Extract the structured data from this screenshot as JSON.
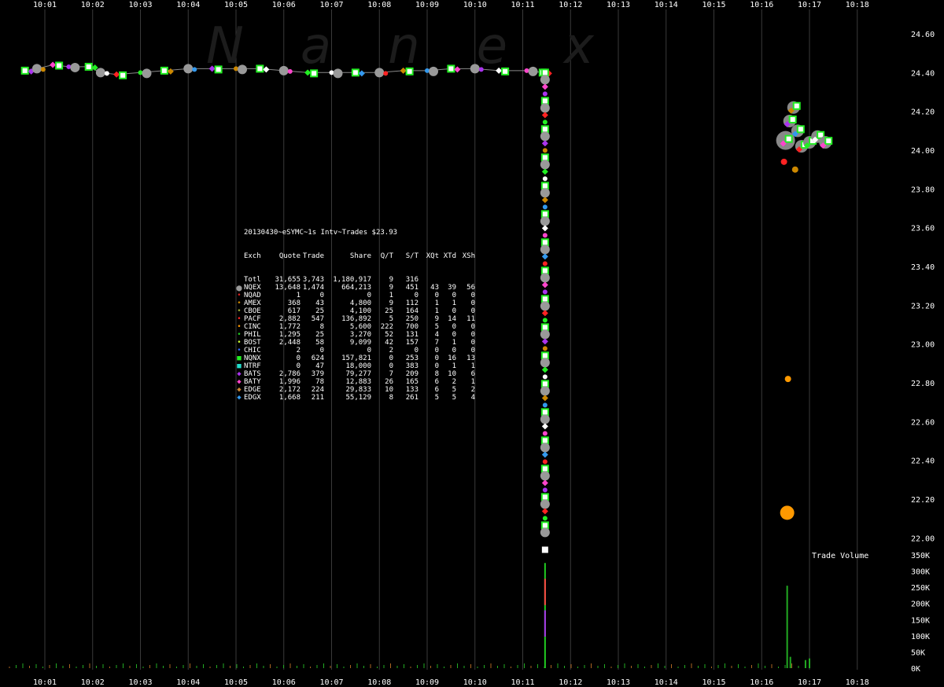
{
  "watermark": "Nanex",
  "stats_title": "20130430~eSYMC~1s Intv~Trades $23.93",
  "stats_header": [
    "Exch",
    "Quote",
    "Trade",
    "Share",
    "Q/T",
    "S/T",
    "XQt",
    "XTd",
    "XSh"
  ],
  "stats_rows": [
    {
      "exch": "Totl",
      "quote": "31,655",
      "trade": "3,743",
      "share": "1,180,917",
      "qt": "9",
      "st": "316",
      "xqt": "",
      "xtd": "",
      "xsh": "",
      "color": "",
      "shape": ""
    },
    {
      "exch": "NQEX",
      "quote": "13,648",
      "trade": "1,474",
      "share": "664,213",
      "qt": "9",
      "st": "451",
      "xqt": "43",
      "xtd": "39",
      "xsh": "56",
      "color": "#999999",
      "shape": "big-circle"
    },
    {
      "exch": "NQAD",
      "quote": "1",
      "trade": "0",
      "share": "0",
      "qt": "1",
      "st": "0",
      "xqt": "0",
      "xtd": "0",
      "xsh": "0",
      "color": "#dd2222",
      "shape": "dot"
    },
    {
      "exch": "AMEX",
      "quote": "368",
      "trade": "43",
      "share": "4,800",
      "qt": "9",
      "st": "112",
      "xqt": "1",
      "xtd": "1",
      "xsh": "0",
      "color": "#cc8800",
      "shape": "dot"
    },
    {
      "exch": "CBOE",
      "quote": "617",
      "trade": "25",
      "share": "4,100",
      "qt": "25",
      "st": "164",
      "xqt": "1",
      "xtd": "0",
      "xsh": "0",
      "color": "#99aa33",
      "shape": "dot"
    },
    {
      "exch": "PACF",
      "quote": "2,882",
      "trade": "547",
      "share": "136,892",
      "qt": "5",
      "st": "250",
      "xqt": "9",
      "xtd": "14",
      "xsh": "11",
      "color": "#ff2222",
      "shape": "dot"
    },
    {
      "exch": "CINC",
      "quote": "1,772",
      "trade": "8",
      "share": "5,600",
      "qt": "222",
      "st": "700",
      "xqt": "5",
      "xtd": "0",
      "xsh": "0",
      "color": "#ff9900",
      "shape": "dot"
    },
    {
      "exch": "PHIL",
      "quote": "1,295",
      "trade": "25",
      "share": "3,270",
      "qt": "52",
      "st": "131",
      "xqt": "4",
      "xtd": "0",
      "xsh": "0",
      "color": "#22cc22",
      "shape": "dot"
    },
    {
      "exch": "BOST",
      "quote": "2,448",
      "trade": "58",
      "share": "9,099",
      "qt": "42",
      "st": "157",
      "xqt": "7",
      "xtd": "1",
      "xsh": "0",
      "color": "#ccff33",
      "shape": "dot"
    },
    {
      "exch": "CHIC",
      "quote": "2",
      "trade": "0",
      "share": "0",
      "qt": "2",
      "st": "0",
      "xqt": "0",
      "xtd": "0",
      "xsh": "0",
      "color": "#3366ff",
      "shape": "dot"
    },
    {
      "exch": "NQNX",
      "quote": "0",
      "trade": "624",
      "share": "157,821",
      "qt": "0",
      "st": "253",
      "xqt": "0",
      "xtd": "16",
      "xsh": "13",
      "color": "#22ee22",
      "shape": "square"
    },
    {
      "exch": "NTRF",
      "quote": "0",
      "trade": "47",
      "share": "18,000",
      "qt": "0",
      "st": "383",
      "xqt": "0",
      "xtd": "1",
      "xsh": "1",
      "color": "#22ddcc",
      "shape": "square"
    },
    {
      "exch": "BATS",
      "quote": "2,786",
      "trade": "379",
      "share": "79,277",
      "qt": "7",
      "st": "209",
      "xqt": "8",
      "xtd": "10",
      "xsh": "6",
      "color": "#aa33ee",
      "shape": "diamond"
    },
    {
      "exch": "BATY",
      "quote": "1,996",
      "trade": "78",
      "share": "12,883",
      "qt": "26",
      "st": "165",
      "xqt": "6",
      "xtd": "2",
      "xsh": "1",
      "color": "#ff44cc",
      "shape": "diamond"
    },
    {
      "exch": "EDGE",
      "quote": "2,172",
      "trade": "224",
      "share": "29,833",
      "qt": "10",
      "st": "133",
      "xqt": "6",
      "xtd": "5",
      "xsh": "2",
      "color": "#cc8833",
      "shape": "diamond"
    },
    {
      "exch": "EDGX",
      "quote": "1,668",
      "trade": "211",
      "share": "55,129",
      "qt": "8",
      "st": "261",
      "xqt": "5",
      "xtd": "5",
      "xsh": "4",
      "color": "#3399ee",
      "shape": "diamond"
    }
  ],
  "volume_label": "Trade Volume",
  "chart_data": {
    "type": "scatter",
    "title": "",
    "x_tick_labels": [
      "10:01",
      "10:02",
      "10:03",
      "10:04",
      "10:05",
      "10:06",
      "10:07",
      "10:08",
      "10:09",
      "10:10",
      "10:11",
      "10:12",
      "10:13",
      "10:14",
      "10:15",
      "10:16",
      "10:17",
      "10:18"
    ],
    "price_axis": {
      "min": 21.95,
      "max": 24.65,
      "ticks": [
        24.6,
        24.4,
        24.2,
        24.0,
        23.8,
        23.6,
        23.4,
        23.2,
        23.0,
        22.8,
        22.6,
        22.4,
        22.2,
        22.0
      ]
    },
    "volume_axis": {
      "min": 0,
      "max": 350000,
      "ticks": [
        "350K",
        "300K",
        "250K",
        "200K",
        "150K",
        "100K",
        "50K",
        "0K"
      ]
    },
    "grid": true,
    "price_line": [
      {
        "t": "10:00:35",
        "p": 24.41
      },
      {
        "t": "10:00:50",
        "p": 24.42
      },
      {
        "t": "10:01:10",
        "p": 24.44
      },
      {
        "t": "10:01:30",
        "p": 24.43
      },
      {
        "t": "10:01:55",
        "p": 24.43
      },
      {
        "t": "10:02:10",
        "p": 24.4
      },
      {
        "t": "10:02:30",
        "p": 24.39
      },
      {
        "t": "10:03:00",
        "p": 24.4
      },
      {
        "t": "10:03:30",
        "p": 24.41
      },
      {
        "t": "10:04:00",
        "p": 24.42
      },
      {
        "t": "10:04:30",
        "p": 24.42
      },
      {
        "t": "10:05:00",
        "p": 24.42
      },
      {
        "t": "10:05:30",
        "p": 24.42
      },
      {
        "t": "10:06:00",
        "p": 24.41
      },
      {
        "t": "10:06:30",
        "p": 24.4
      },
      {
        "t": "10:07:00",
        "p": 24.4
      },
      {
        "t": "10:07:30",
        "p": 24.4
      },
      {
        "t": "10:08:00",
        "p": 24.4
      },
      {
        "t": "10:08:30",
        "p": 24.41
      },
      {
        "t": "10:09:00",
        "p": 24.41
      },
      {
        "t": "10:09:30",
        "p": 24.42
      },
      {
        "t": "10:10:00",
        "p": 24.42
      },
      {
        "t": "10:10:30",
        "p": 24.41
      },
      {
        "t": "10:11:05",
        "p": 24.41
      },
      {
        "t": "10:11:25",
        "p": 24.4
      }
    ],
    "crash_column": {
      "t": "10:11:28",
      "p_high": 24.4,
      "p_low": 22.0
    },
    "recovery_cluster": [
      {
        "t": "10:16:30",
        "p": 24.05
      },
      {
        "t": "10:16:35",
        "p": 24.15
      },
      {
        "t": "10:16:40",
        "p": 24.22
      },
      {
        "t": "10:16:45",
        "p": 24.1
      },
      {
        "t": "10:16:50",
        "p": 24.02
      },
      {
        "t": "10:17:00",
        "p": 24.04
      },
      {
        "t": "10:17:10",
        "p": 24.07
      },
      {
        "t": "10:17:20",
        "p": 24.04
      }
    ],
    "outliers": [
      {
        "t": "10:16:28",
        "p": 23.94,
        "exch": "PACF"
      },
      {
        "t": "10:16:42",
        "p": 23.9,
        "exch": "AMEX"
      },
      {
        "t": "10:16:33",
        "p": 22.82,
        "exch": "CINC"
      },
      {
        "t": "10:16:32",
        "p": 22.13,
        "exch": "CINC"
      }
    ],
    "volume_spikes": [
      {
        "t": "10:11:28",
        "v": 325000
      },
      {
        "t": "10:16:32",
        "v": 255000
      },
      {
        "t": "10:16:36",
        "v": 35000
      },
      {
        "t": "10:16:55",
        "v": 25000
      },
      {
        "t": "10:17:00",
        "v": 30000
      }
    ]
  }
}
